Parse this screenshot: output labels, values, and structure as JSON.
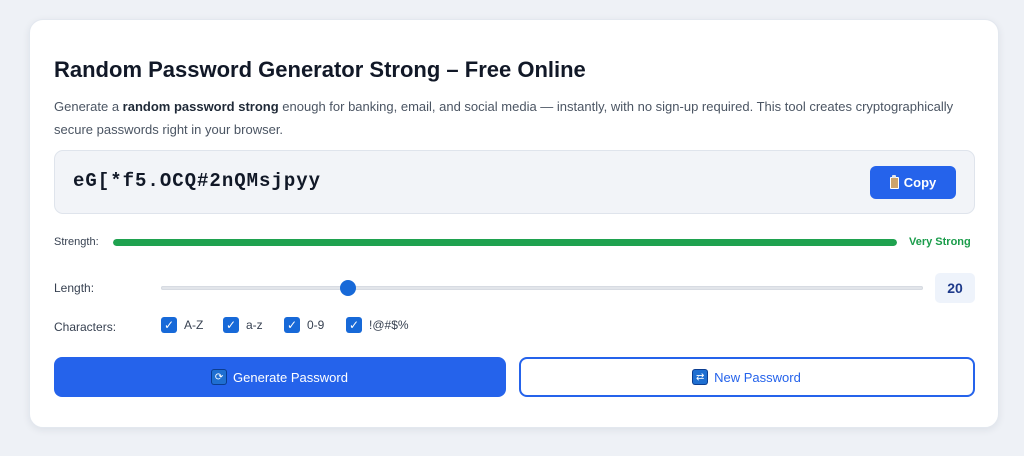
{
  "title": "Random Password Generator Strong – Free Online",
  "description": {
    "prefix": "Generate a ",
    "bold": "random password strong",
    "suffix": " enough for banking, email, and social media — instantly, with no sign-up required. This tool creates cryptographically secure passwords right in your browser."
  },
  "password": "eG[*f5.OCQ#2nQMsjpyy",
  "copy_button": {
    "label": "Copy",
    "icon": "clipboard-icon"
  },
  "strength": {
    "label": "Strength:",
    "value": "Very Strong",
    "level": 1.0,
    "color": "#1fa24f"
  },
  "length": {
    "label": "Length:",
    "value": "20",
    "slider_fraction": 0.245
  },
  "characters": {
    "label": "Characters:",
    "options": [
      {
        "label": "A-Z",
        "checked": true
      },
      {
        "label": "a-z",
        "checked": true
      },
      {
        "label": "0-9",
        "checked": true
      },
      {
        "label": "!@#$%",
        "checked": true
      }
    ]
  },
  "generate_button": {
    "label": "Generate Password",
    "icon": "refresh-icon"
  },
  "new_button": {
    "label": "New Password",
    "icon": "repeat-icon"
  },
  "colors": {
    "accent": "#2563eb",
    "strength": "#1fa24f"
  }
}
